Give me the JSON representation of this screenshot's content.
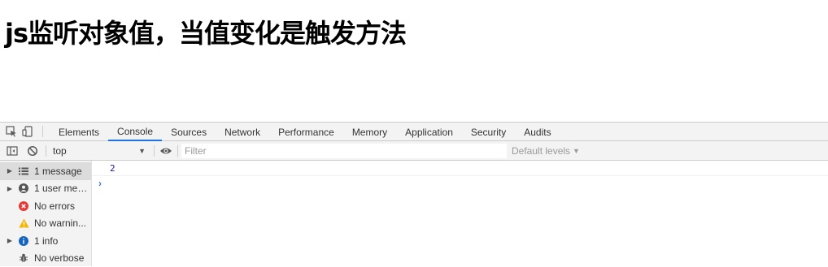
{
  "page": {
    "title": "js监听对象值，当值变化是触发方法"
  },
  "devtools": {
    "tabs": [
      {
        "label": "Elements",
        "active": false
      },
      {
        "label": "Console",
        "active": true
      },
      {
        "label": "Sources",
        "active": false
      },
      {
        "label": "Network",
        "active": false
      },
      {
        "label": "Performance",
        "active": false
      },
      {
        "label": "Memory",
        "active": false
      },
      {
        "label": "Application",
        "active": false
      },
      {
        "label": "Security",
        "active": false
      },
      {
        "label": "Audits",
        "active": false
      }
    ],
    "toolbar": {
      "context": "top",
      "filter_placeholder": "Filter",
      "filter_value": "",
      "levels_label": "Default levels"
    },
    "sidebar": {
      "items": [
        {
          "label": "1 message",
          "icon": "list-icon",
          "expandable": true,
          "selected": true
        },
        {
          "label": "1 user mes...",
          "icon": "user-icon",
          "expandable": true,
          "selected": false
        },
        {
          "label": "No errors",
          "icon": "error-icon",
          "expandable": false,
          "selected": false
        },
        {
          "label": "No warnin...",
          "icon": "warning-icon",
          "expandable": false,
          "selected": false
        },
        {
          "label": "1 info",
          "icon": "info-icon",
          "expandable": true,
          "selected": false
        },
        {
          "label": "No verbose",
          "icon": "bug-icon",
          "expandable": false,
          "selected": false
        }
      ]
    },
    "console": {
      "log_value": "2",
      "prompt": "›"
    },
    "colors": {
      "accent": "#1a73e8",
      "error": "#e53935",
      "warning": "#f4b400",
      "info": "#1565c0",
      "log_number": "#1a1aa6"
    }
  }
}
